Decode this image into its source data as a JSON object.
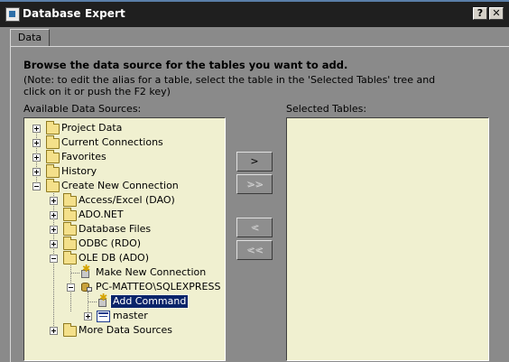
{
  "window": {
    "title": "Database Expert",
    "help_label": "?",
    "close_label": "✕"
  },
  "tabs": [
    {
      "label": "Data"
    }
  ],
  "heading": "Browse the data source for the tables you want to add.",
  "note": "(Note: to edit the alias for a table, select the table in the 'Selected Tables' tree and click on it or push the F2 key)",
  "available_label": "Available Data Sources:",
  "selected_label": "Selected Tables:",
  "tree": {
    "project_data": "Project Data",
    "current_connections": "Current Connections",
    "favorites": "Favorites",
    "history": "History",
    "create_new_connection": "Create New Connection",
    "access_excel": "Access/Excel (DAO)",
    "ado_net": "ADO.NET",
    "database_files": "Database Files",
    "odbc": "ODBC (RDO)",
    "ole_db": "OLE DB (ADO)",
    "make_new_connection": "Make New Connection",
    "server": "PC-MATTEO\\SQLEXPRESS",
    "add_command": "Add Command",
    "master": "master",
    "more_data_sources": "More Data Sources"
  },
  "buttons": {
    "add": ">",
    "add_all": ">>",
    "remove": "<",
    "remove_all": "<<"
  }
}
